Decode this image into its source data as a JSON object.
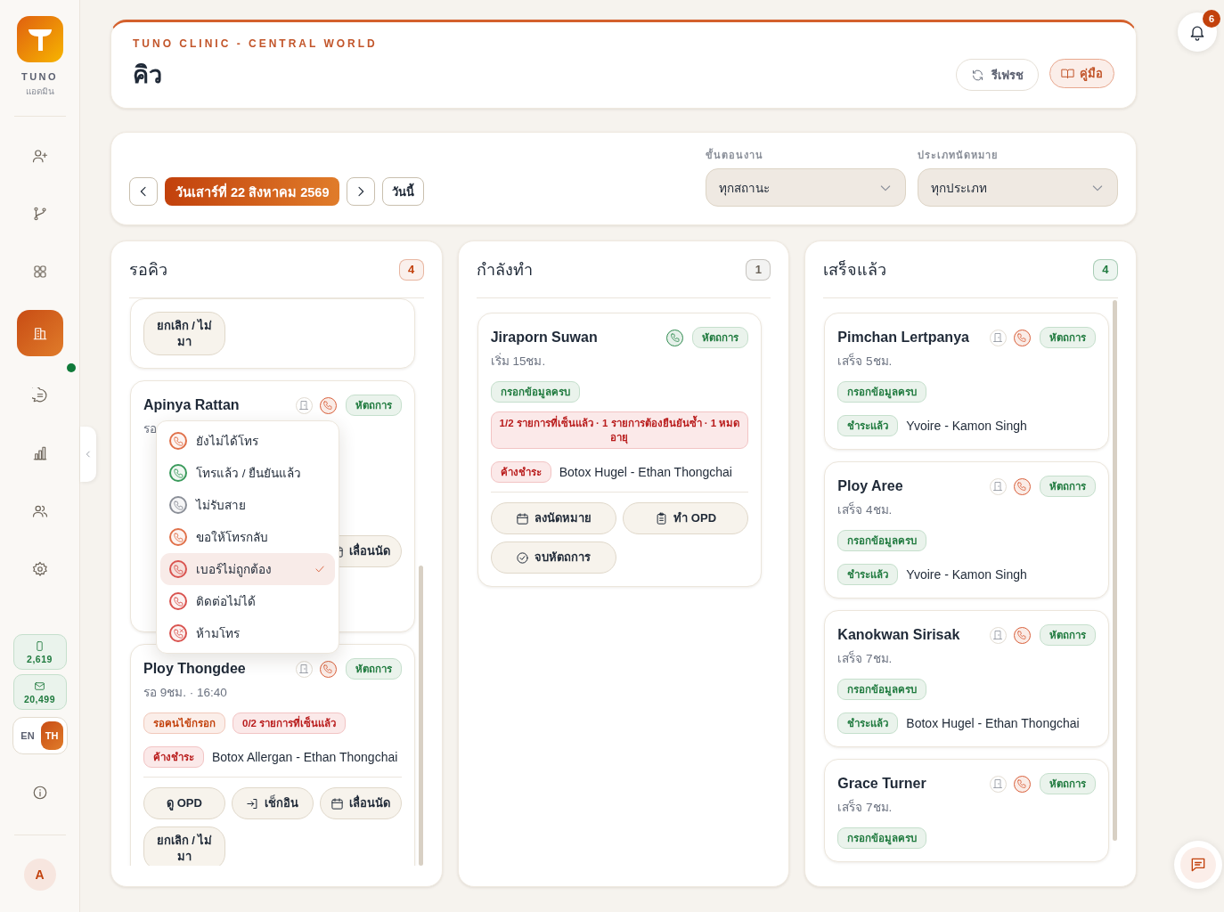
{
  "sidebar": {
    "brand": "TUNO",
    "role": "แอดมิน",
    "nav": [
      {
        "kind": "add-user",
        "selected": false
      },
      {
        "kind": "branch",
        "selected": false
      },
      {
        "kind": "grid",
        "selected": false
      },
      {
        "kind": "building",
        "selected": true
      },
      {
        "kind": "chat",
        "selected": false,
        "unread": true
      },
      {
        "kind": "chart",
        "selected": false
      },
      {
        "kind": "users",
        "selected": false
      },
      {
        "kind": "settings",
        "selected": false
      }
    ],
    "counters": [
      {
        "kind": "sms",
        "value": "2,619"
      },
      {
        "kind": "email",
        "value": "20,499"
      }
    ],
    "languages": [
      {
        "label": "EN",
        "selected": false
      },
      {
        "label": "TH",
        "selected": true
      }
    ],
    "avatar": "A"
  },
  "header": {
    "clinic": "TUNO CLINIC - CENTRAL WORLD",
    "title": "คิว",
    "buttons": [
      {
        "label": "รีเฟรช",
        "kind": "refresh"
      },
      {
        "label": "คู่มือ",
        "kind": "guide"
      }
    ]
  },
  "notifications": {
    "count": "6"
  },
  "date_nav": {
    "date": "วันเสาร์ที่ 22 สิงหาคม 2569",
    "today": "วันนี้"
  },
  "filters": [
    {
      "label": "ขั้นตอนงาน",
      "value": "ทุกสถานะ"
    },
    {
      "label": "ประเภทนัดหมาย",
      "value": "ทุกประเภท"
    }
  ],
  "columns": [
    {
      "title": "รอคิว",
      "count": "4",
      "color": "#c2410c",
      "cards": [
        {
          "actions": [
            {
              "label": "ยกเลิก / ไม่มา",
              "kind": "cancel"
            }
          ]
        },
        {
          "name": "Apinya Rattan",
          "room": true,
          "phone": {
            "color": "#d9603b"
          },
          "type": "หัตถการ",
          "time": "รอ",
          "actions": [
            {
              "label": "เลื่อนนัด",
              "kind": "reschedule"
            }
          ],
          "call_menu": [
            {
              "label": "ยังไม่ได้โทร",
              "kind": "phone",
              "color": "#e0714a",
              "selected": false
            },
            {
              "label": "โทรแล้ว / ยืนยันแล้ว",
              "kind": "phone",
              "color": "#3a9a5b",
              "selected": false
            },
            {
              "label": "ไม่รับสาย",
              "kind": "phone",
              "color": "#8b8f98",
              "selected": false
            },
            {
              "label": "ขอให้โทรกลับ",
              "kind": "phone",
              "color": "#e0714a",
              "selected": false
            },
            {
              "label": "เบอร์ไม่ถูกต้อง",
              "kind": "phone",
              "color": "#d9534f",
              "selected": true
            },
            {
              "label": "ติดต่อไม่ได้",
              "kind": "phone",
              "color": "#d9534f",
              "selected": false
            },
            {
              "label": "ห้ามโทร",
              "kind": "blocked",
              "color": "#d9534f",
              "selected": false
            }
          ]
        },
        {
          "name": "Ploy Thongdee",
          "room": true,
          "phone": {
            "color": "#d9603b"
          },
          "type": "หัตถการ",
          "time": "รอ 9ชม. · 16:40",
          "tags": [
            {
              "text": "รอคนไข้กรอก",
              "kind": "warning"
            },
            {
              "text": "0/2 รายการที่เซ็นแล้ว",
              "kind": "error"
            }
          ],
          "payment": {
            "status": "ค้างชำระ",
            "kind": "error",
            "item": "Botox Allergan - Ethan Thongchai"
          },
          "actions": [
            {
              "label": "ดู OPD",
              "kind": "view-opd"
            },
            {
              "label": "เช็กอิน",
              "kind": "check-in"
            },
            {
              "label": "เลื่อนนัด",
              "kind": "reschedule"
            },
            {
              "label": "ยกเลิก / ไม่มา",
              "kind": "cancel"
            }
          ]
        }
      ]
    },
    {
      "title": "กำลังทำ",
      "count": "1",
      "color": "#6b6358",
      "cards": [
        {
          "name": "Jiraporn Suwan",
          "room": false,
          "phone": {
            "color": "#2f8a4f"
          },
          "type": "หัตถการ",
          "time": "เริ่ม 15ชม.",
          "tags": [
            {
              "text": "กรอกข้อมูลครบ",
              "kind": "success"
            }
          ],
          "alert": "1/2 รายการที่เซ็นแล้ว · 1 รายการต้องยืนยันซ้ำ · 1 หมดอายุ",
          "payment": {
            "status": "ค้างชำระ",
            "kind": "error",
            "item": "Botox Hugel - Ethan Thongchai"
          },
          "actions": [
            {
              "label": "ลงนัดหมาย",
              "kind": "book"
            },
            {
              "label": "ทำ OPD",
              "kind": "opd"
            },
            {
              "label": "จบหัตถการ",
              "kind": "finish"
            }
          ]
        }
      ]
    },
    {
      "title": "เสร็จแล้ว",
      "count": "4",
      "color": "#1f7a3e",
      "cards": [
        {
          "name": "Pimchan Lertpanya",
          "room": true,
          "phone": {
            "color": "#d9603b"
          },
          "type": "หัตถการ",
          "time": "เสร็จ 5ชม.",
          "tags": [
            {
              "text": "กรอกข้อมูลครบ",
              "kind": "success"
            }
          ],
          "payment": {
            "status": "ชำระแล้ว",
            "kind": "success",
            "item": "Yvoire - Kamon Singh"
          }
        },
        {
          "name": "Ploy Aree",
          "room": true,
          "phone": {
            "color": "#d9603b"
          },
          "type": "หัตถการ",
          "time": "เสร็จ 4ชม.",
          "tags": [
            {
              "text": "กรอกข้อมูลครบ",
              "kind": "success"
            }
          ],
          "payment": {
            "status": "ชำระแล้ว",
            "kind": "success",
            "item": "Yvoire - Kamon Singh"
          }
        },
        {
          "name": "Kanokwan Sirisak",
          "room": true,
          "phone": {
            "color": "#d9603b"
          },
          "type": "หัตถการ",
          "time": "เสร็จ 7ชม.",
          "tags": [
            {
              "text": "กรอกข้อมูลครบ",
              "kind": "success"
            }
          ],
          "payment": {
            "status": "ชำระแล้ว",
            "kind": "success",
            "item": "Botox Hugel - Ethan Thongchai"
          }
        },
        {
          "name": "Grace Turner",
          "room": true,
          "phone": {
            "color": "#d9603b"
          },
          "type": "หัตถการ",
          "time": "เสร็จ 7ชม.",
          "tags": [
            {
              "text": "กรอกข้อมูลครบ",
              "kind": "success"
            }
          ]
        }
      ]
    }
  ]
}
